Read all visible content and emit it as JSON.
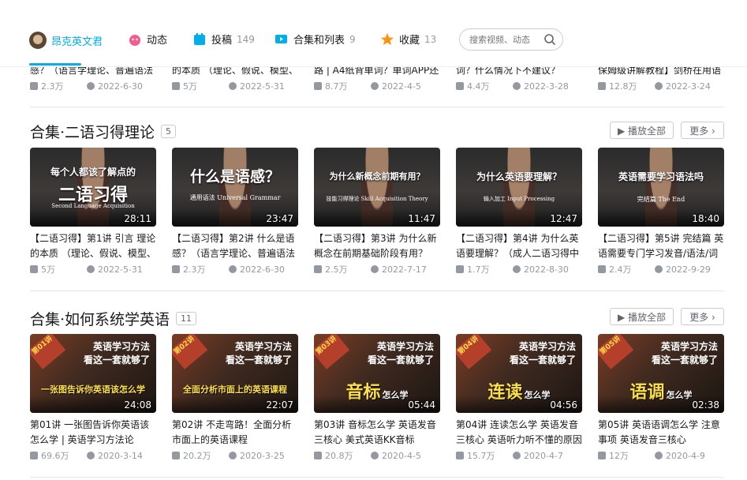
{
  "nav": {
    "items": [
      {
        "label": "昂克英文君",
        "count": ""
      },
      {
        "label": "动态",
        "count": ""
      },
      {
        "label": "投稿",
        "count": "149"
      },
      {
        "label": "合集和列表",
        "count": "9"
      },
      {
        "label": "收藏",
        "count": "13"
      }
    ],
    "search_placeholder": "搜索视频、动态"
  },
  "prev_row": [
    {
      "title_tail": "感？（语言学理论、普遍语法",
      "views": "2.3万",
      "date": "2022-6-30"
    },
    {
      "title_tail": "的本质 （理论、假说、模型、",
      "views": "5万",
      "date": "2022-5-31"
    },
    {
      "title_tail": "路 | A4纸背单词？单词APP还",
      "views": "8.7万",
      "date": "2022-4-5"
    },
    {
      "title_tail": "词？什么情况下不建议？",
      "views": "4.4万",
      "date": "2022-3-28"
    },
    {
      "title_tail": "保姆级讲解教程】剑桥在用语",
      "views": "12.8万",
      "date": "2022-3-24"
    }
  ],
  "sections": [
    {
      "title": "合集·二语习得理论",
      "count": "5",
      "play_all": "▶ 播放全部",
      "more": "更多 ›",
      "videos": [
        {
          "thumb_top": "每个人都该了解点的",
          "thumb_main": "二语习得",
          "thumb_sub": "Second Language Acquisition",
          "duration": "28:11",
          "title": "【二语习得】第1讲 引言 理论的本质 （理论、假说、模型、",
          "views": "5万",
          "date": "2022-5-31"
        },
        {
          "thumb_top": "",
          "thumb_main": "什么是语感？",
          "thumb_sub": "通用语法  Universal Grammar",
          "duration": "23:47",
          "title": "【二语习得】第2讲 什么是语感？（语言学理论、普遍语法",
          "views": "2.3万",
          "date": "2022-6-30"
        },
        {
          "thumb_top": "",
          "thumb_main": "为什么新概念前期有用？",
          "thumb_sub": "技能习得理论  Skill Acquisition Theory",
          "duration": "11:47",
          "title": "【二语习得】第3讲 为什么新概念在前期基础阶段有用？",
          "views": "2.5万",
          "date": "2022-7-17"
        },
        {
          "thumb_top": "",
          "thumb_main": "为什么英语要理解？",
          "thumb_sub": "输入加工  Input Processing",
          "duration": "12:47",
          "title": "【二语习得】第4讲 为什么英语要理解？（成人二语习得中",
          "views": "1.7万",
          "date": "2022-8-30"
        },
        {
          "thumb_top": "",
          "thumb_main": "英语需要学习语法吗",
          "thumb_sub": "完结篇  The End",
          "duration": "18:40",
          "title": "【二语习得】第5讲 完结篇 英语需要专门学习发音/语法/词",
          "views": "2.4万",
          "date": "2022-9-29"
        }
      ]
    },
    {
      "title": "合集·如何系统学英语",
      "count": "11",
      "play_all": "▶ 播放全部",
      "more": "更多 ›",
      "videos": [
        {
          "badge": "第01讲",
          "head1": "英语学习方法",
          "head2": "看这一套就够了",
          "main": "一张图告诉你英语该怎么学",
          "duration": "24:08",
          "title": "第01讲 一张图告诉你英语该怎么学 | 英语学习方法论",
          "views": "69.6万",
          "date": "2020-3-14"
        },
        {
          "badge": "第02讲",
          "head1": "英语学习方法",
          "head2": "看这一套就够了",
          "main": "全面分析市面上的英语课程",
          "duration": "22:07",
          "title": "第02讲 不走弯路！全面分析市面上的英语课程",
          "views": "20.2万",
          "date": "2020-3-25"
        },
        {
          "badge": "第03讲",
          "head1": "英语学习方法",
          "head2": "看这一套就够了",
          "main": "音标",
          "duration": "05:44",
          "title": "第03讲 音标怎么学 英语发音三核心 美式英语KK音标",
          "views": "20.8万",
          "date": "2020-4-5"
        },
        {
          "badge": "第04讲",
          "head1": "英语学习方法",
          "head2": "看这一套就够了",
          "main": "连读",
          "duration": "04:56",
          "title": "第04讲 连读怎么学 英语发音三核心 英语听力听不懂的原因",
          "views": "15.7万",
          "date": "2020-4-7"
        },
        {
          "badge": "第05讲",
          "head1": "英语学习方法",
          "head2": "看这一套就够了",
          "main": "语调",
          "duration": "02:38",
          "title": "第05讲 英语语调怎么学 注意事项 英语发音三核心",
          "views": "12万",
          "date": "2020-4-9"
        }
      ]
    }
  ],
  "thumb_suffix": "怎么学",
  "colors": {
    "accent": "#00aeec",
    "muted": "#9499a0"
  }
}
